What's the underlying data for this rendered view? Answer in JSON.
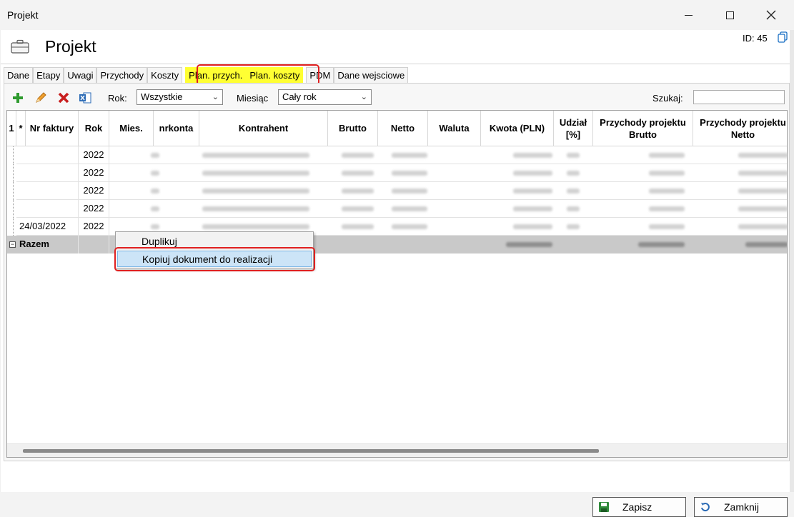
{
  "window": {
    "title": "Projekt"
  },
  "header": {
    "title": "Projekt",
    "record_id": "ID: 45"
  },
  "tabs": [
    {
      "label": "Dane",
      "highlighted": false
    },
    {
      "label": "Etapy",
      "highlighted": false
    },
    {
      "label": "Uwagi",
      "highlighted": false
    },
    {
      "label": "Przychody",
      "highlighted": false
    },
    {
      "label": "Koszty",
      "highlighted": false
    },
    {
      "label": "Plan. przych.",
      "highlighted": true
    },
    {
      "label": "Plan. koszty",
      "highlighted": true
    },
    {
      "label": "PDM",
      "highlighted": false
    },
    {
      "label": "Dane wejsciowe",
      "highlighted": false
    }
  ],
  "toolbar": {
    "icons": [
      "add-icon",
      "edit-icon",
      "delete-icon",
      "excel-export-icon"
    ],
    "rok_label": "Rok:",
    "rok_value": "Wszystkie",
    "miesiac_label": "Miesiąc",
    "miesiac_value": "Cały rok",
    "search_label": "Szukaj:",
    "search_value": ""
  },
  "grid": {
    "columns": [
      "1",
      "*",
      "Nr faktury",
      "Rok",
      "Mies.",
      "nrkonta",
      "Kontrahent",
      "Brutto",
      "Netto",
      "Waluta",
      "Kwota (PLN)",
      "Udział [%]",
      "Przychody projektu Brutto",
      "Przychody projektu Netto"
    ],
    "rows": [
      {
        "date": "",
        "rok": "2022"
      },
      {
        "date": "",
        "rok": "2022"
      },
      {
        "date": "",
        "rok": "2022"
      },
      {
        "date": "",
        "rok": "2022"
      },
      {
        "date": "24/03/2022",
        "rok": "2022"
      }
    ],
    "totals_label": "Razem"
  },
  "context_menu": {
    "items": [
      {
        "label": "Duplikuj",
        "selected": false
      },
      {
        "label": "Kopiuj dokument do realizacji",
        "selected": true
      }
    ]
  },
  "footer": {
    "save_label": "Zapisz",
    "close_label": "Zamknij"
  },
  "colors": {
    "tab_highlight": "#ffff33",
    "annotation_red": "#e02020",
    "menu_selection": "#cce4f7",
    "totals_row": "#c9c9c9"
  }
}
